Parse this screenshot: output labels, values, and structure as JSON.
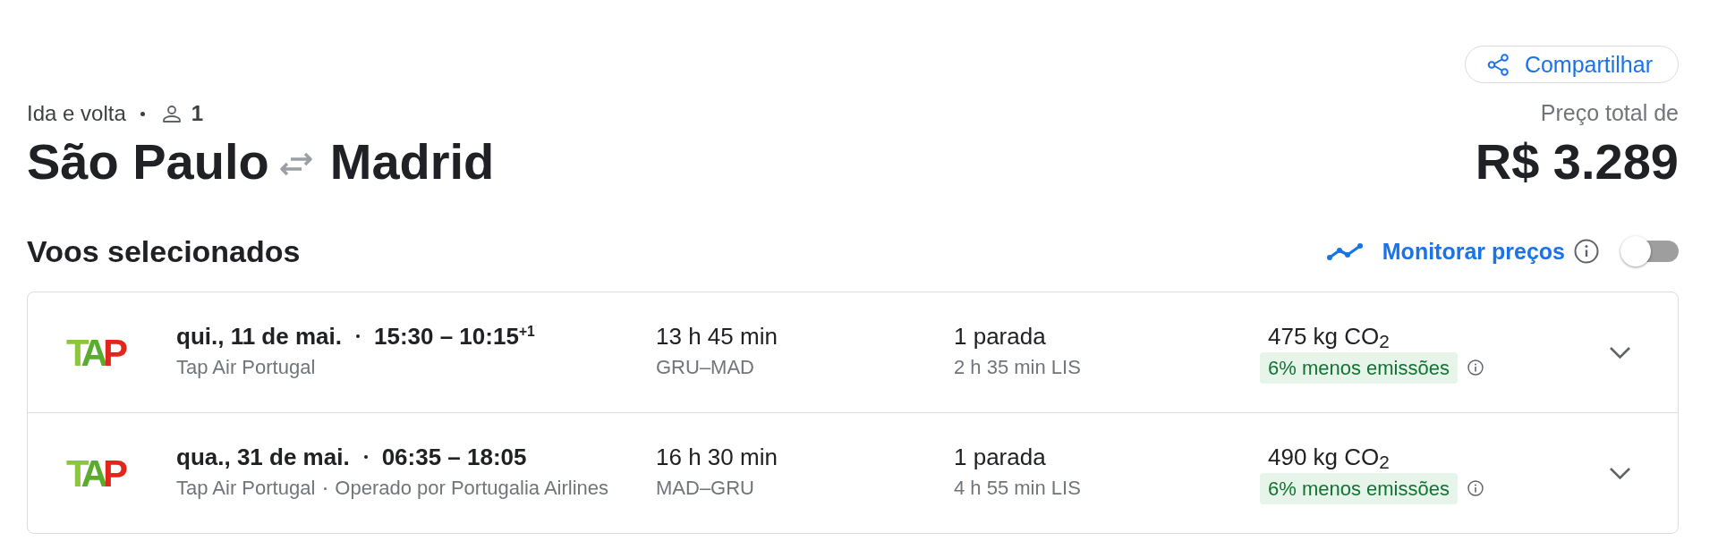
{
  "header": {
    "trip_type": "Ida e volta",
    "passengers": "1",
    "origin": "São Paulo",
    "destination": "Madrid",
    "share_button": "Compartilhar",
    "price_label": "Preço total de",
    "price": "R$ 3.289"
  },
  "selected_flights": {
    "title": "Voos selecionados",
    "price_tracking": {
      "label": "Monitorar preços",
      "on": false
    }
  },
  "flights": [
    {
      "airline_logo": "TAP",
      "date": "qui., 11 de mai.",
      "times": "15:30 – 10:15$^{+1}$",
      "airline": "Tap Air Portugal",
      "duration": "13 h 45 min",
      "route": "GRU–MAD",
      "stops": "1 parada",
      "layover": "2 h 35 min LIS",
      "emissions": "475 kg CO$_{2}$",
      "emissions_badge": "6% menos emissões",
      "expanded": false
    },
    {
      "airline_logo": "TAP",
      "date": "qua., 31 de mai.",
      "times": "06:35 – 18:05",
      "airline": "Tap Air Portugal",
      "operator": "Operado por Portugalia Airlines",
      "duration": "16 h 30 min",
      "route": "MAD–GRU",
      "stops": "1 parada",
      "layover": "4 h 55 min LIS",
      "emissions": "490 kg CO$_{2}$",
      "emissions_badge": "6% menos emissões",
      "expanded": false
    }
  ]
}
